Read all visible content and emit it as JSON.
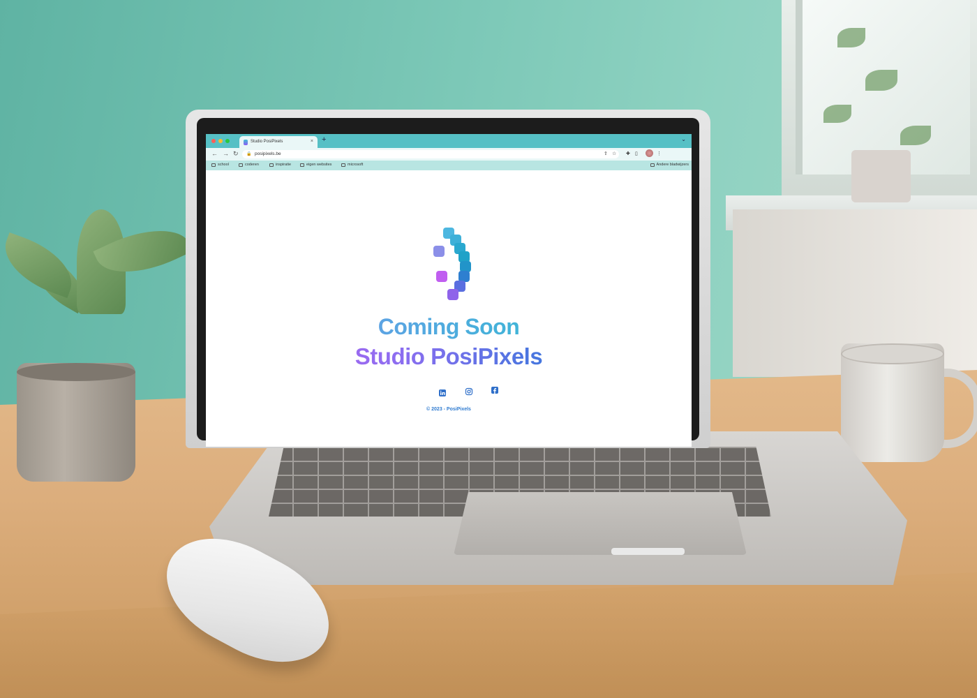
{
  "browser": {
    "tab_title": "Studio PosiPixels",
    "tab_close": "×",
    "new_tab": "+",
    "url": "posipixels.be",
    "bookmarks": [
      "school",
      "coderen",
      "inspiratie",
      "eigen websites",
      "microsoft"
    ],
    "all_bookmarks": "Andere bladwijzers"
  },
  "page": {
    "headline_1": "Coming Soon",
    "headline_2": "Studio PosiPixels",
    "social": [
      "linkedin-icon",
      "instagram-icon",
      "facebook-icon"
    ],
    "copyright": "© 2023 - PosiPixels"
  },
  "colors": {
    "accent_teal": "#3cb7d6",
    "accent_purple": "#c661f2",
    "accent_blue": "#2f7bd0",
    "tabbar": "#56c0c5"
  }
}
